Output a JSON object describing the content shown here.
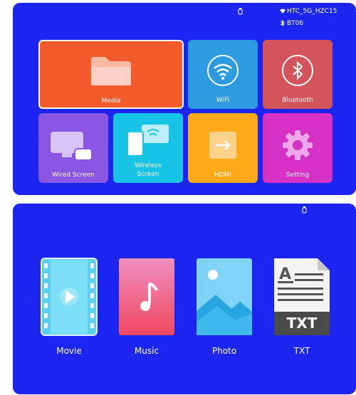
{
  "screen1": {
    "status": {
      "wifi_name": "HTC_5G_HZC15",
      "bt_name": "BT06"
    },
    "tiles": {
      "media": {
        "label": "Media",
        "color": "#f35a2c"
      },
      "wifi": {
        "label": "WiFi",
        "color": "#2c9be0"
      },
      "bluetooth": {
        "label": "Bluetooth",
        "color": "#d3545a"
      },
      "wired_screen": {
        "label": "Wired Screen",
        "color": "#8a55e0"
      },
      "wireless_screen": {
        "label_line1": "Wireless",
        "label_line2": "Screen",
        "color": "#16c4e6"
      },
      "hdmi": {
        "label": "HDMI",
        "color": "#ffa818"
      },
      "setting": {
        "label": "Setting",
        "color": "#d430c4"
      }
    }
  },
  "screen2": {
    "items": [
      {
        "label": "Movie",
        "icon": "movie-icon"
      },
      {
        "label": "Music",
        "icon": "music-icon"
      },
      {
        "label": "Photo",
        "icon": "photo-icon"
      },
      {
        "label": "TXT",
        "icon": "txt-icon"
      }
    ],
    "txt_icon_text": "TXT"
  }
}
